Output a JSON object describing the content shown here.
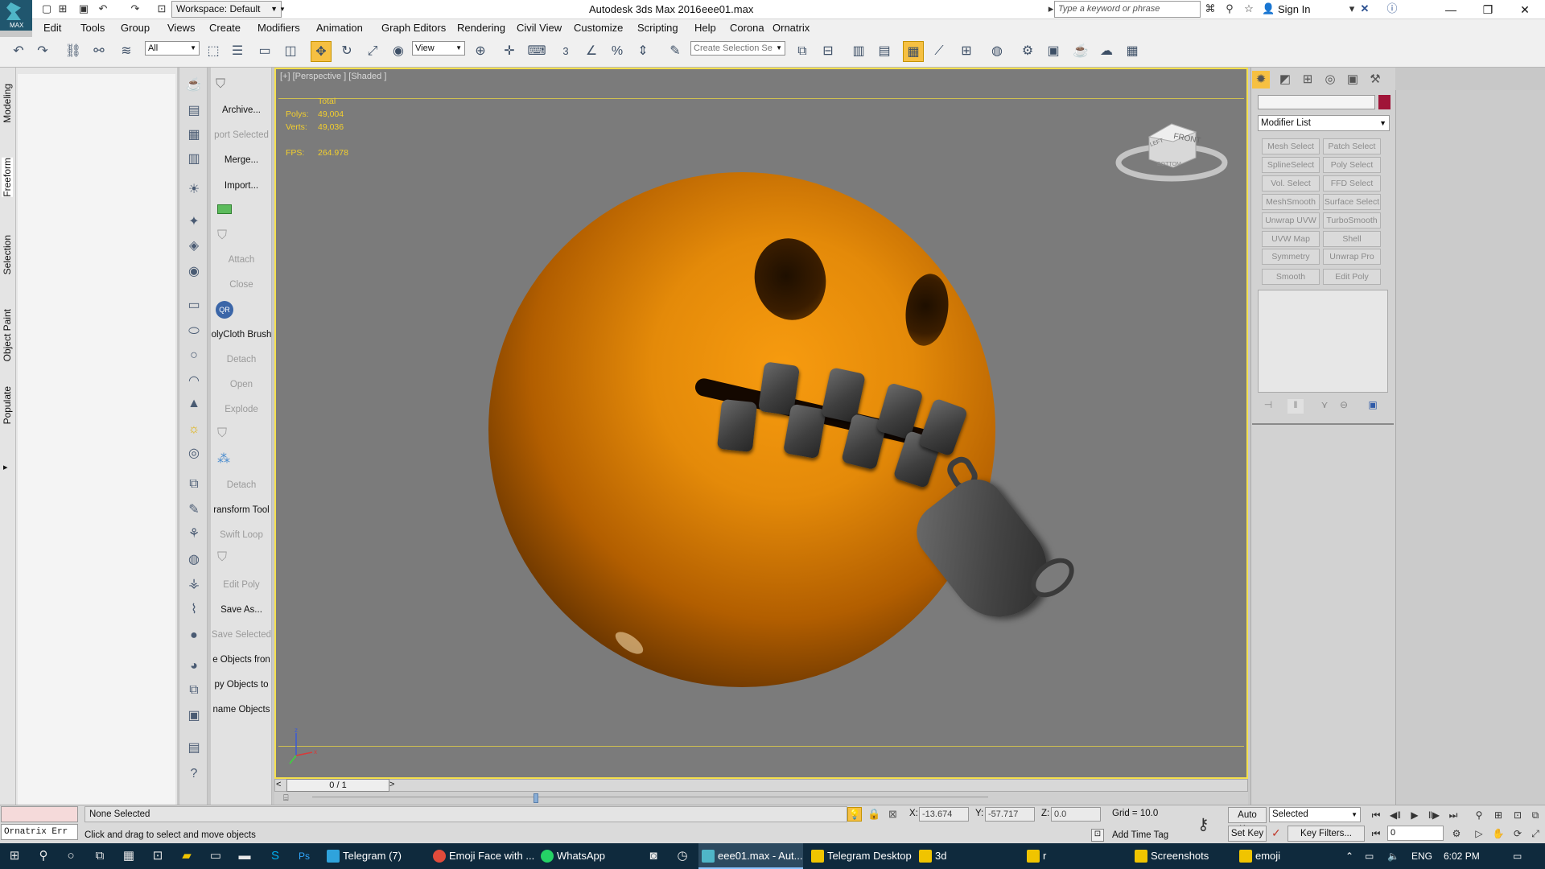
{
  "titlebar": {
    "app_logo_text": "MAX",
    "workspace": "Workspace: Default",
    "app_name": "Autodesk 3ds Max 2016",
    "file_name": "eee01.max",
    "search_placeholder": "Type a keyword or phrase",
    "sign_in": "Sign In"
  },
  "menu": [
    "Edit",
    "Tools",
    "Group",
    "Views",
    "Create",
    "Modifiers",
    "Animation",
    "Graph Editors",
    "Rendering",
    "Civil View",
    "Customize",
    "Scripting",
    "Help",
    "Corona",
    "Ornatrix"
  ],
  "toolbar": {
    "filter_value": "All",
    "ref_coord_value": "View",
    "snap_label": "3",
    "named_sel_placeholder": "Create Selection Se"
  },
  "ribbon_tabs": [
    "Modeling",
    "Freeform",
    "Selection",
    "Object Paint",
    "Populate"
  ],
  "command_column": [
    {
      "label": "Archive...",
      "dim": false
    },
    {
      "label": "port Selected",
      "dim": true
    },
    {
      "label": "Merge...",
      "dim": false
    },
    {
      "label": "Import...",
      "dim": false
    },
    {
      "label": "Attach",
      "dim": true
    },
    {
      "label": "Close",
      "dim": true
    },
    {
      "label": "olyCloth Brush",
      "dim": false
    },
    {
      "label": "Detach",
      "dim": true
    },
    {
      "label": "Open",
      "dim": true
    },
    {
      "label": "Explode",
      "dim": true
    },
    {
      "label": "Detach",
      "dim": true
    },
    {
      "label": "ransform Tool",
      "dim": false
    },
    {
      "label": "Swift Loop",
      "dim": true
    },
    {
      "label": "Edit Poly",
      "dim": true
    },
    {
      "label": "Save As...",
      "dim": false
    },
    {
      "label": "Save Selected",
      "dim": true
    },
    {
      "label": "e Objects fron",
      "dim": false
    },
    {
      "label": "py Objects to",
      "dim": false
    },
    {
      "label": "name Objects",
      "dim": false
    }
  ],
  "viewport": {
    "label": "[+] [Perspective ] [Shaded ]",
    "stats": {
      "total_label": "Total",
      "polys_label": "Polys:",
      "polys_value": "49,004",
      "verts_label": "Verts:",
      "verts_value": "49,036",
      "fps_label": "FPS:",
      "fps_value": "264.978"
    },
    "viewcube_front": "FRONT",
    "viewcube_left": "LEFT",
    "viewcube_bottom": "BOTTOM"
  },
  "timeline": {
    "frame_display": "0 / 1"
  },
  "command_panel": {
    "modifier_list": "Modifier List",
    "modifiers": [
      "Mesh Select",
      "Patch Select",
      "SplineSelect",
      "Poly Select",
      "Vol. Select",
      "FFD Select",
      "MeshSmooth",
      "Surface Select",
      "Unwrap UVW",
      "TurboSmooth",
      "UVW Map",
      "Shell",
      "Symmetry",
      "Unwrap Pro",
      "Smooth",
      "Edit Poly"
    ],
    "object_color": "#a01438"
  },
  "status": {
    "script_listener_text": "Ornatrix Err",
    "selection": "None Selected",
    "prompt": "Click and drag to select and move objects",
    "x_label": "X:",
    "x_value": "-13.674",
    "y_label": "Y:",
    "y_value": "-57.717",
    "z_label": "Z:",
    "z_value": "0.0",
    "grid": "Grid = 10.0",
    "add_time_tag": "Add Time Tag",
    "auto_key": "Auto Key",
    "set_key": "Set Key",
    "selected_drop": "Selected",
    "key_filters": "Key Filters...",
    "frame_value": "0"
  },
  "taskbar": {
    "items": [
      {
        "label": "Telegram (7)",
        "color": "#2fa3dc",
        "active": false
      },
      {
        "label": "Emoji Face with ...",
        "color": "#e14b3b",
        "active": false
      },
      {
        "label": "WhatsApp",
        "color": "#25d366",
        "active": false
      },
      {
        "label": "eee01.max - Aut...",
        "color": "#4fb5c7",
        "active": true
      },
      {
        "label": "Telegram Desktop",
        "color": "#f0c400",
        "active": false
      },
      {
        "label": "3d",
        "color": "#f0c400",
        "active": false
      },
      {
        "label": "r",
        "color": "#f0c400",
        "active": false
      },
      {
        "label": "Screenshots",
        "color": "#f0c400",
        "active": false
      },
      {
        "label": "emoji",
        "color": "#f0c400",
        "active": false
      }
    ],
    "lang": "ENG",
    "time": "6:02 PM"
  },
  "icons": [
    "app-logo",
    "new-file-icon",
    "open-file-icon",
    "save-icon",
    "undo-icon",
    "redo-icon",
    "project-icon",
    "binoculars-icon",
    "star-icon",
    "user-icon",
    "help-icon",
    "minimize-icon",
    "restore-icon",
    "close-icon",
    "select-move-icon",
    "rotate-icon",
    "scale-icon",
    "key-icon",
    "windows-start-icon",
    "search-icon",
    "cortana-icon",
    "task-view-icon"
  ]
}
